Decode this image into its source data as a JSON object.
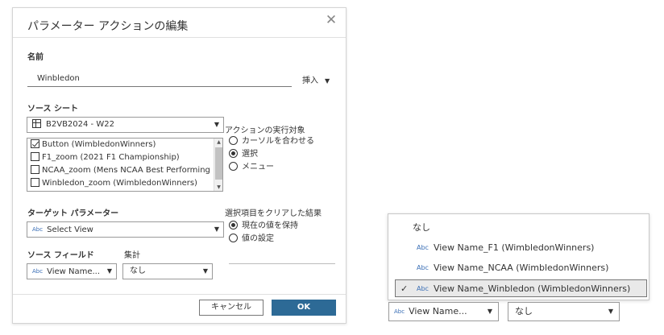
{
  "dialog": {
    "title": "パラメーター アクションの編集",
    "close_glyph": "✕",
    "name_label": "名前",
    "name_value": "Winbledon",
    "insert_label": "挿入",
    "source_sheets_label": "ソース シート",
    "source_sheet_selected": "B2VB2024 - W22",
    "sheets": [
      {
        "label": "Button (WimbledonWinners)",
        "checked": true
      },
      {
        "label": "F1_zoom (2021 F1 Championship)",
        "checked": false
      },
      {
        "label": "NCAA_zoom (Mens NCAA Best Performing",
        "checked": false
      },
      {
        "label": "Winbledon_zoom (WimbledonWinners)",
        "checked": false
      }
    ],
    "run_action_label": "アクションの実行対象",
    "run_options": [
      {
        "label": "カーソルを合わせる",
        "selected": false
      },
      {
        "label": "選択",
        "selected": true
      },
      {
        "label": "メニュー",
        "selected": false
      }
    ],
    "target_param_label": "ターゲット パラメーター",
    "target_param_value": "Select View",
    "clear_label": "選択項目をクリアした結果",
    "clear_options": [
      {
        "label": "現在の値を保持",
        "selected": true
      },
      {
        "label": "値の設定",
        "selected": false
      }
    ],
    "source_field_label": "ソース フィールド",
    "aggregate_label": "集計",
    "source_field_value": "View Name...",
    "aggregate_value": "なし",
    "cancel_label": "キャンセル",
    "ok_label": "OK",
    "abc_tag": "Abc"
  },
  "dropdown": {
    "items": [
      {
        "label": "なし",
        "abc": false,
        "selected": false
      },
      {
        "label": "View Name_F1 (WimbledonWinners)",
        "abc": true,
        "selected": false
      },
      {
        "label": "View Name_NCAA (WimbledonWinners)",
        "abc": true,
        "selected": false
      },
      {
        "label": "View Name_Winbledon (WimbledonWinners)",
        "abc": true,
        "selected": true
      }
    ],
    "check_glyph": "✓",
    "field_value": "View Name...",
    "aggregate_value": "なし"
  },
  "colors": {
    "ok_button": "#2d6a96",
    "abc_icon": "#3b6fb6"
  }
}
